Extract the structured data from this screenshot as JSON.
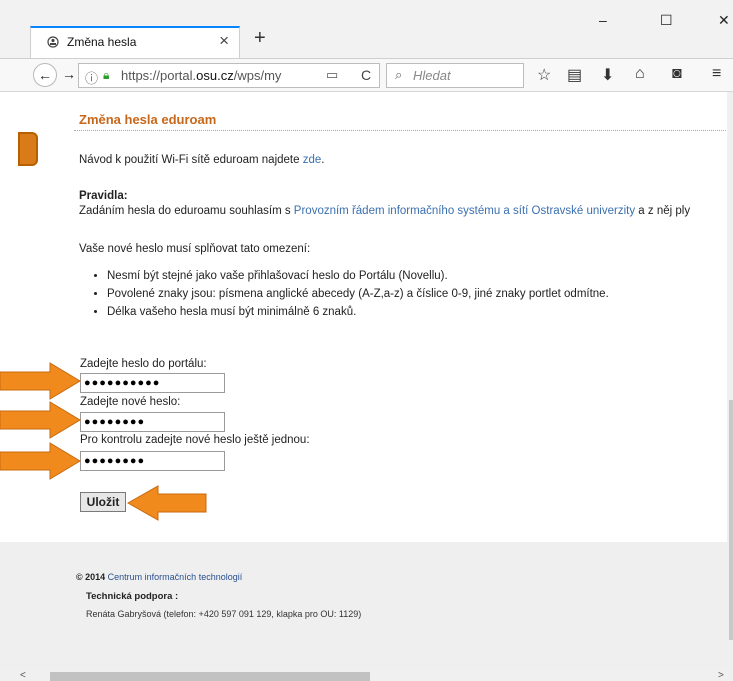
{
  "browser": {
    "tab_title": "Změna hesla",
    "tab_close": "×",
    "new_tab": "+",
    "window": {
      "minimize": "–",
      "maximize": "☐",
      "close": "✕"
    },
    "url_prefix": "https://portal.",
    "url_domain": "osu.cz",
    "url_suffix": "/wps/my",
    "search_placeholder": "Hledat"
  },
  "page": {
    "portlet_title": "Změna hesla eduroam",
    "intro_text": "Návod k použití Wi-Fi sítě eduroam najdete ",
    "intro_link": "zde",
    "intro_end": ".",
    "rules_heading": "Pravidla:",
    "rules_text_start": "Zadáním hesla do eduroamu souhlasím s ",
    "rules_link": "Provozním řádem informačního systému a sítí Ostravské univerzity",
    "rules_text_end": " a z něj ply",
    "constraints_intro": "Vaše nové heslo musí splňovat tato omezení:",
    "constraints": [
      "Nesmí být stejné jako vaše přihlašovací heslo do Portálu (Novellu).",
      "Povolené znaky jsou: písmena anglické abecedy (A-Z,a-z) a číslice 0-9, jiné znaky portlet odmítne.",
      "Délka vašeho hesla musí být minimálně 6 znaků."
    ],
    "form": {
      "portal_password_label": "Zadejte heslo do portálu:",
      "portal_password_value": "●●●●●●●●●●",
      "new_password_label": "Zadejte nové heslo:",
      "new_password_value": "●●●●●●●●",
      "confirm_password_label": "Pro kontrolu zadejte nové heslo ještě jednou:",
      "confirm_password_value": "●●●●●●●●",
      "save_label": "Uložit"
    }
  },
  "footer": {
    "copyright_year": "© 2014",
    "copyright_org": " Centrum informačních technologií",
    "support_heading": "Technická podpora :",
    "support_contact": "Renáta Gabryšová (telefon: +420 597 091 129, klapka pro OU: 1129)"
  },
  "colors": {
    "accent_orange": "#f08a1c",
    "title_orange": "#c7671a",
    "link_blue": "#3a6fb0"
  }
}
